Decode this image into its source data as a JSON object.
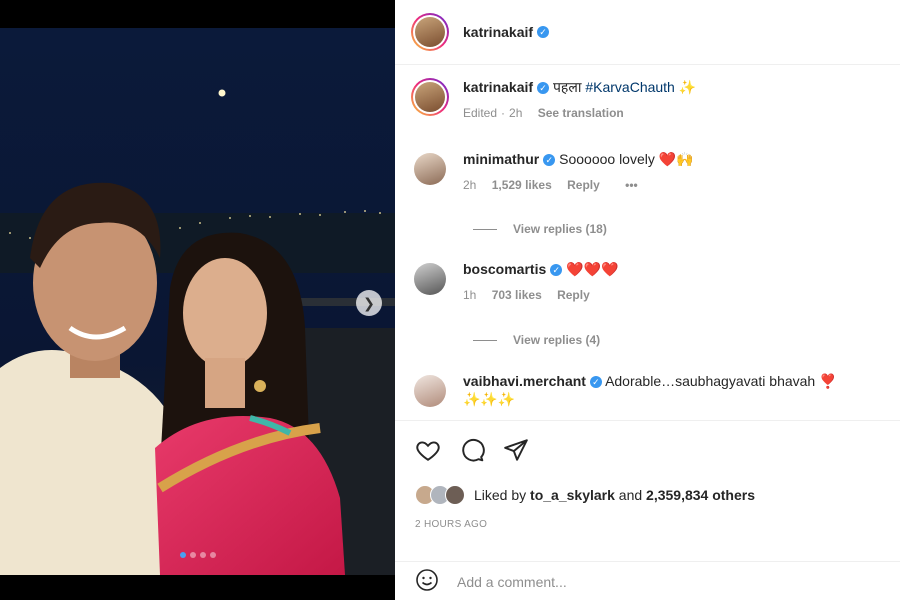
{
  "post": {
    "username": "katrinakaif",
    "verified_mark": "✓",
    "slide_count": 4,
    "active_slide": 1
  },
  "caption": {
    "username": "katrinakaif",
    "text": "पहला",
    "hashtag": "#KarvaChauth",
    "emoji": "✨",
    "edited": "Edited",
    "time": "2h",
    "see_translation": "See translation"
  },
  "comments": [
    {
      "username": "minimathur",
      "text": "Soooooo lovely",
      "emoji": "❤️🙌",
      "time": "2h",
      "likes": "1,529 likes",
      "reply": "Reply",
      "more": "•••",
      "view_replies": "View replies (18)"
    },
    {
      "username": "boscomartis",
      "text": "",
      "emoji": "❤️❤️❤️",
      "time": "1h",
      "likes": "703 likes",
      "reply": "Reply",
      "view_replies": "View replies (4)"
    },
    {
      "username": "vaibhavi.merchant",
      "text": "Adorable…saubhagyavati bhavah",
      "emoji": "❣️",
      "emoji2": "✨✨✨"
    }
  ],
  "likes": {
    "prefix": "Liked by",
    "user": "to_a_skylark",
    "and": "and",
    "count": "2,359,834 others"
  },
  "timeago": "2 HOURS AGO",
  "add_comment": {
    "placeholder": "Add a comment..."
  },
  "icons": {
    "like": "heart-icon",
    "comment": "comment-icon",
    "share": "share-icon",
    "emoji": "emoji-icon",
    "next": "chevron-right-icon"
  },
  "colors": {
    "link": "#00376b",
    "verified": "#3897f0",
    "muted": "#8e8e8e",
    "heart": "#ed1c24"
  }
}
